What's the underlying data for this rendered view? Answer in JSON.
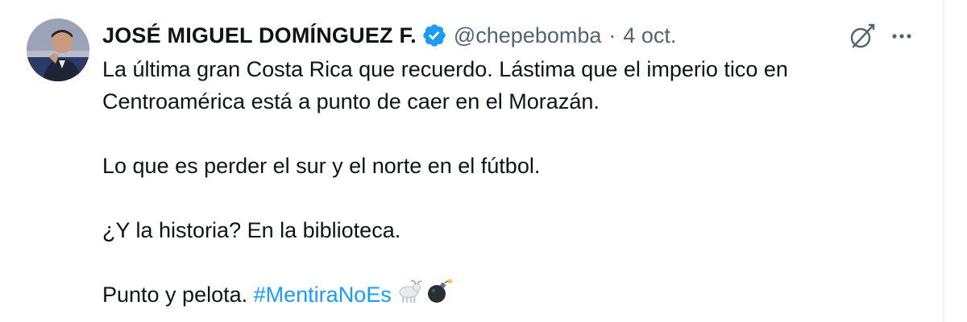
{
  "author": {
    "display_name": "JOSÉ MIGUEL DOMÍNGUEZ F.",
    "handle": "@chepebomba",
    "separator": "·",
    "date": "4 oct."
  },
  "tweet": {
    "paragraph_1": "La última gran Costa Rica que recuerdo. Lástima que el imperio tico en Centroamérica está a punto de caer en el Morazán.",
    "paragraph_2": "Lo que es perder el sur y el norte en el fútbol.",
    "paragraph_3": "¿Y la historia? En la biblioteca.",
    "paragraph_4_text": "Punto y pelota. ",
    "hashtag": "#MentiraNoEs",
    "emojis": [
      "goat-emoji",
      "bomb-emoji"
    ]
  },
  "colors": {
    "text": "#0f1419",
    "secondary": "#536471",
    "link": "#1d9bf0",
    "verified": "#1d9bf0"
  },
  "icons": [
    "verified-badge-icon",
    "grok-icon",
    "more-options-icon"
  ]
}
